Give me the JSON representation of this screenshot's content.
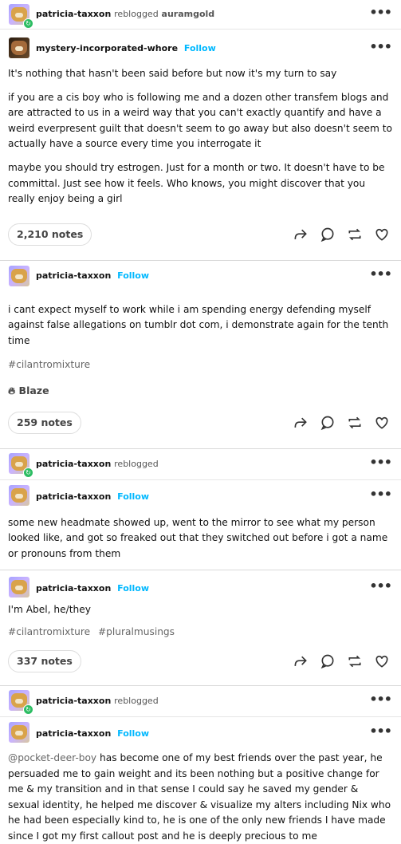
{
  "reblog_header_1": {
    "user": "patricia-taxxon",
    "action": "reblogged",
    "source": "auramgold"
  },
  "post_1": {
    "user": "mystery-incorporated-whore",
    "follow": "Follow",
    "paragraphs": [
      "It's nothing that hasn't been said before but now it's my turn to say",
      "if you are a cis boy who is following me and a dozen other transfem blogs and are attracted to us in a weird way that you can't exactly quantify and have a weird everpresent guilt that doesn't seem to go away but also doesn't seem to actually have a source every time you interrogate it",
      "maybe you should try estrogen. Just for a month or two. It doesn't have to be committal. Just see how it feels. Who knows, you might discover that you really enjoy being a girl"
    ],
    "notes": "2,210 notes"
  },
  "post_2": {
    "user": "patricia-taxxon",
    "follow": "Follow",
    "text": "i cant expect myself to work while i am spending energy defending myself against false allegations on tumblr dot com, i demonstrate again for the tenth time",
    "tags": [
      "#cilantromixture"
    ],
    "blaze": "Blaze",
    "notes": "259 notes"
  },
  "reblog_header_2": {
    "user": "patricia-taxxon",
    "action": "reblogged"
  },
  "post_3": {
    "user": "patricia-taxxon",
    "follow": "Follow",
    "text": "some new headmate showed up, went to the mirror to see what my person looked like, and got so freaked out that they switched out before i got a name or pronouns from them"
  },
  "post_3b": {
    "user": "patricia-taxxon",
    "follow": "Follow",
    "text": "I'm Abel, he/they",
    "tags": [
      "#cilantromixture",
      "#pluralmusings"
    ],
    "notes": "337 notes"
  },
  "reblog_header_3": {
    "user": "patricia-taxxon",
    "action": "reblogged"
  },
  "post_4": {
    "user": "patricia-taxxon",
    "follow": "Follow",
    "mention": "@pocket-deer-boy",
    "text": " has become one of my best friends over the past year, he persuaded me to gain weight and its been nothing but a positive change for me & my transition and in that sense I could say he saved my gender & sexual identity, he helped me discover & visualize my alters including Nix who he had been especially kind to, he is one of the only new friends I have made since I got my first callout post and he is deeply precious to me"
  },
  "colors": {
    "follow": "#00b8ff",
    "badge": "#2dbd63"
  },
  "icons": [
    "share-icon",
    "reply-icon",
    "reblog-icon",
    "like-icon",
    "flame-icon",
    "more-icon"
  ]
}
